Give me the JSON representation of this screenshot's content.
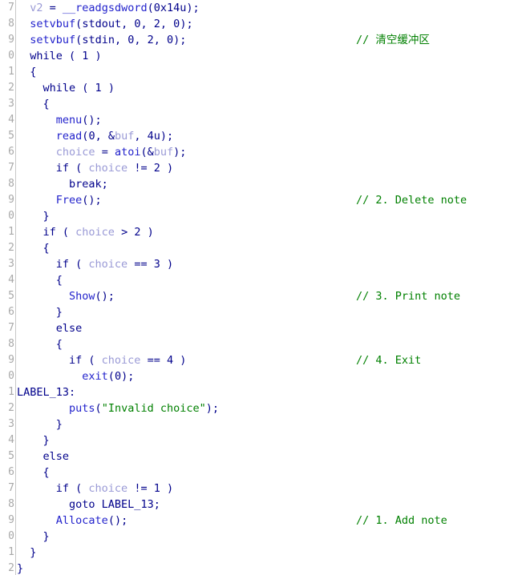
{
  "view": {
    "name": "hex-rays-pseudocode",
    "colors": {
      "background": "#ffffff",
      "keyword": "#00008b",
      "function": "#2222cc",
      "variable": "#9a9ad6",
      "comment": "#008000",
      "string": "#008000",
      "line_number": "#a8a8a8",
      "gutter_border": "#c8c8c8"
    }
  },
  "gutter": {
    "line_numbers": [
      "7",
      "8",
      "9",
      "0",
      "1",
      "2",
      "3",
      "4",
      "5",
      "6",
      "7",
      "8",
      "9",
      "0",
      "1",
      "2",
      "3",
      "4",
      "5",
      "6",
      "7",
      "8",
      "9",
      "0",
      "1",
      "2",
      "3",
      "4",
      "5",
      "6",
      "7",
      "8",
      "9",
      "0",
      "1",
      "2"
    ]
  },
  "lines": [
    {
      "n": "7",
      "tokens": [
        {
          "t": "  ",
          "c": "k"
        },
        {
          "t": "v2",
          "c": "var"
        },
        {
          "t": " = ",
          "c": "k"
        },
        {
          "t": "__readgsdword",
          "c": "fn"
        },
        {
          "t": "(",
          "c": "k"
        },
        {
          "t": "0x14u",
          "c": "num"
        },
        {
          "t": ");",
          "c": "k"
        }
      ],
      "comment": ""
    },
    {
      "n": "8",
      "tokens": [
        {
          "t": "  ",
          "c": "k"
        },
        {
          "t": "setvbuf",
          "c": "fn"
        },
        {
          "t": "(",
          "c": "k"
        },
        {
          "t": "stdout",
          "c": "k"
        },
        {
          "t": ", ",
          "c": "k"
        },
        {
          "t": "0",
          "c": "num"
        },
        {
          "t": ", ",
          "c": "k"
        },
        {
          "t": "2",
          "c": "num"
        },
        {
          "t": ", ",
          "c": "k"
        },
        {
          "t": "0",
          "c": "num"
        },
        {
          "t": ");",
          "c": "k"
        }
      ],
      "comment": ""
    },
    {
      "n": "9",
      "tokens": [
        {
          "t": "  ",
          "c": "k"
        },
        {
          "t": "setvbuf",
          "c": "fn"
        },
        {
          "t": "(",
          "c": "k"
        },
        {
          "t": "stdin",
          "c": "k"
        },
        {
          "t": ", ",
          "c": "k"
        },
        {
          "t": "0",
          "c": "num"
        },
        {
          "t": ", ",
          "c": "k"
        },
        {
          "t": "2",
          "c": "num"
        },
        {
          "t": ", ",
          "c": "k"
        },
        {
          "t": "0",
          "c": "num"
        },
        {
          "t": ");",
          "c": "k"
        }
      ],
      "comment": "// 清空缓冲区"
    },
    {
      "n": "0",
      "tokens": [
        {
          "t": "  while ( ",
          "c": "k"
        },
        {
          "t": "1",
          "c": "num"
        },
        {
          "t": " )",
          "c": "k"
        }
      ],
      "comment": ""
    },
    {
      "n": "1",
      "tokens": [
        {
          "t": "  {",
          "c": "k"
        }
      ],
      "comment": ""
    },
    {
      "n": "2",
      "tokens": [
        {
          "t": "    while ( ",
          "c": "k"
        },
        {
          "t": "1",
          "c": "num"
        },
        {
          "t": " )",
          "c": "k"
        }
      ],
      "comment": ""
    },
    {
      "n": "3",
      "tokens": [
        {
          "t": "    {",
          "c": "k"
        }
      ],
      "comment": ""
    },
    {
      "n": "4",
      "tokens": [
        {
          "t": "      ",
          "c": "k"
        },
        {
          "t": "menu",
          "c": "fn"
        },
        {
          "t": "();",
          "c": "k"
        }
      ],
      "comment": ""
    },
    {
      "n": "5",
      "tokens": [
        {
          "t": "      ",
          "c": "k"
        },
        {
          "t": "read",
          "c": "fn"
        },
        {
          "t": "(",
          "c": "k"
        },
        {
          "t": "0",
          "c": "num"
        },
        {
          "t": ", &",
          "c": "k"
        },
        {
          "t": "buf",
          "c": "var"
        },
        {
          "t": ", ",
          "c": "k"
        },
        {
          "t": "4u",
          "c": "num"
        },
        {
          "t": ");",
          "c": "k"
        }
      ],
      "comment": ""
    },
    {
      "n": "6",
      "tokens": [
        {
          "t": "      ",
          "c": "k"
        },
        {
          "t": "choice",
          "c": "var"
        },
        {
          "t": " = ",
          "c": "k"
        },
        {
          "t": "atoi",
          "c": "fn"
        },
        {
          "t": "(&",
          "c": "k"
        },
        {
          "t": "buf",
          "c": "var"
        },
        {
          "t": ");",
          "c": "k"
        }
      ],
      "comment": ""
    },
    {
      "n": "7",
      "tokens": [
        {
          "t": "      if ( ",
          "c": "k"
        },
        {
          "t": "choice",
          "c": "var"
        },
        {
          "t": " != ",
          "c": "k"
        },
        {
          "t": "2",
          "c": "num"
        },
        {
          "t": " )",
          "c": "k"
        }
      ],
      "comment": ""
    },
    {
      "n": "8",
      "tokens": [
        {
          "t": "        break;",
          "c": "k"
        }
      ],
      "comment": ""
    },
    {
      "n": "9",
      "tokens": [
        {
          "t": "      ",
          "c": "k"
        },
        {
          "t": "Free",
          "c": "fn"
        },
        {
          "t": "();",
          "c": "k"
        }
      ],
      "comment": "// 2. Delete note"
    },
    {
      "n": "0",
      "tokens": [
        {
          "t": "    }",
          "c": "k"
        }
      ],
      "comment": ""
    },
    {
      "n": "1",
      "tokens": [
        {
          "t": "    if ( ",
          "c": "k"
        },
        {
          "t": "choice",
          "c": "var"
        },
        {
          "t": " > ",
          "c": "k"
        },
        {
          "t": "2",
          "c": "num"
        },
        {
          "t": " )",
          "c": "k"
        }
      ],
      "comment": ""
    },
    {
      "n": "2",
      "tokens": [
        {
          "t": "    {",
          "c": "k"
        }
      ],
      "comment": ""
    },
    {
      "n": "3",
      "tokens": [
        {
          "t": "      if ( ",
          "c": "k"
        },
        {
          "t": "choice",
          "c": "var"
        },
        {
          "t": " == ",
          "c": "k"
        },
        {
          "t": "3",
          "c": "num"
        },
        {
          "t": " )",
          "c": "k"
        }
      ],
      "comment": ""
    },
    {
      "n": "4",
      "tokens": [
        {
          "t": "      {",
          "c": "k"
        }
      ],
      "comment": ""
    },
    {
      "n": "5",
      "tokens": [
        {
          "t": "        ",
          "c": "k"
        },
        {
          "t": "Show",
          "c": "fn"
        },
        {
          "t": "();",
          "c": "k"
        }
      ],
      "comment": "// 3. Print note"
    },
    {
      "n": "6",
      "tokens": [
        {
          "t": "      }",
          "c": "k"
        }
      ],
      "comment": ""
    },
    {
      "n": "7",
      "tokens": [
        {
          "t": "      else",
          "c": "k"
        }
      ],
      "comment": ""
    },
    {
      "n": "8",
      "tokens": [
        {
          "t": "      {",
          "c": "k"
        }
      ],
      "comment": ""
    },
    {
      "n": "9",
      "tokens": [
        {
          "t": "        if ( ",
          "c": "k"
        },
        {
          "t": "choice",
          "c": "var"
        },
        {
          "t": " == ",
          "c": "k"
        },
        {
          "t": "4",
          "c": "num"
        },
        {
          "t": " )",
          "c": "k"
        }
      ],
      "comment": "// 4. Exit"
    },
    {
      "n": "0",
      "tokens": [
        {
          "t": "          ",
          "c": "k"
        },
        {
          "t": "exit",
          "c": "fn"
        },
        {
          "t": "(",
          "c": "k"
        },
        {
          "t": "0",
          "c": "num"
        },
        {
          "t": ");",
          "c": "k"
        }
      ],
      "comment": ""
    },
    {
      "n": "1",
      "tokens": [
        {
          "t": "LABEL_13:",
          "c": "lbl"
        }
      ],
      "comment": ""
    },
    {
      "n": "2",
      "tokens": [
        {
          "t": "        ",
          "c": "k"
        },
        {
          "t": "puts",
          "c": "fn"
        },
        {
          "t": "(",
          "c": "k"
        },
        {
          "t": "\"Invalid choice\"",
          "c": "str"
        },
        {
          "t": ");",
          "c": "k"
        }
      ],
      "comment": ""
    },
    {
      "n": "3",
      "tokens": [
        {
          "t": "      }",
          "c": "k"
        }
      ],
      "comment": ""
    },
    {
      "n": "4",
      "tokens": [
        {
          "t": "    }",
          "c": "k"
        }
      ],
      "comment": ""
    },
    {
      "n": "5",
      "tokens": [
        {
          "t": "    else",
          "c": "k"
        }
      ],
      "comment": ""
    },
    {
      "n": "6",
      "tokens": [
        {
          "t": "    {",
          "c": "k"
        }
      ],
      "comment": ""
    },
    {
      "n": "7",
      "tokens": [
        {
          "t": "      if ( ",
          "c": "k"
        },
        {
          "t": "choice",
          "c": "var"
        },
        {
          "t": " != ",
          "c": "k"
        },
        {
          "t": "1",
          "c": "num"
        },
        {
          "t": " )",
          "c": "k"
        }
      ],
      "comment": ""
    },
    {
      "n": "8",
      "tokens": [
        {
          "t": "        goto ",
          "c": "k"
        },
        {
          "t": "LABEL_13",
          "c": "lbl"
        },
        {
          "t": ";",
          "c": "k"
        }
      ],
      "comment": ""
    },
    {
      "n": "9",
      "tokens": [
        {
          "t": "      ",
          "c": "k"
        },
        {
          "t": "Allocate",
          "c": "fn"
        },
        {
          "t": "();",
          "c": "k"
        }
      ],
      "comment": "// 1. Add note"
    },
    {
      "n": "0",
      "tokens": [
        {
          "t": "    }",
          "c": "k"
        }
      ],
      "comment": ""
    },
    {
      "n": "1",
      "tokens": [
        {
          "t": "  }",
          "c": "k"
        }
      ],
      "comment": ""
    },
    {
      "n": "2",
      "tokens": [
        {
          "t": "}",
          "c": "k"
        }
      ],
      "comment": ""
    }
  ]
}
